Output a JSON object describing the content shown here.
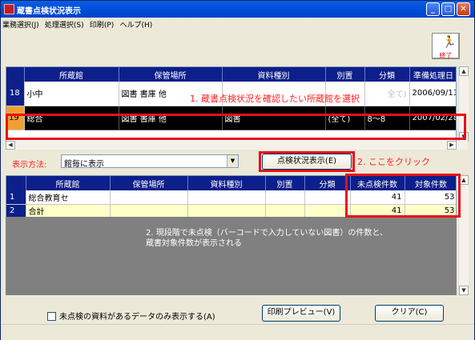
{
  "window": {
    "title": "蔵書点検状況表示"
  },
  "menu": [
    "業務選択(J)",
    "処理選択(S)",
    "印刷(P)",
    "ヘルプ(H)"
  ],
  "exit_button": {
    "label": "終了"
  },
  "top_grid": {
    "headers": [
      "所蔵館",
      "保管場所",
      "資料種別",
      "別置",
      "分類",
      "準備処理日"
    ],
    "rows": [
      {
        "num": "18",
        "cells": [
          "小中",
          "図書 書庫 他",
          "",
          "",
          "全て)",
          "2006/09/13"
        ]
      },
      {
        "num": "19",
        "cells": [
          "総合",
          "図書 書庫 他",
          "図書",
          "(全て)",
          "8〜8",
          "2007/02/28"
        ]
      }
    ]
  },
  "annotations": {
    "a1": "1. 蔵書点検状況を確認したい所蔵館を選択",
    "a2": "2. ここをクリック",
    "a3_line1": "2. 現段階で未点検（バーコードで入力していない図書）の件数と、",
    "a3_line2": "蔵書対象件数が表示される"
  },
  "display_method": {
    "label": "表示方法:",
    "value": "館毎に表示"
  },
  "check_status_button": "点検状況表示(E)",
  "bottom_grid": {
    "headers": [
      "所蔵館",
      "保管場所",
      "資料種別",
      "別置",
      "分類",
      "未点検件数",
      "対象件数"
    ],
    "rows": [
      {
        "num": "1",
        "cells": [
          "総合教育セ",
          "",
          "",
          "",
          "",
          "41",
          "53"
        ]
      },
      {
        "num": "2",
        "cells": [
          "合計",
          "",
          "",
          "",
          "",
          "41",
          "53"
        ]
      }
    ]
  },
  "only_unchecked_checkbox": "未点検の資料があるデータのみ表示する(A)",
  "print_preview_button": "印刷プレビュー(V)",
  "clear_button": "クリア(C)"
}
